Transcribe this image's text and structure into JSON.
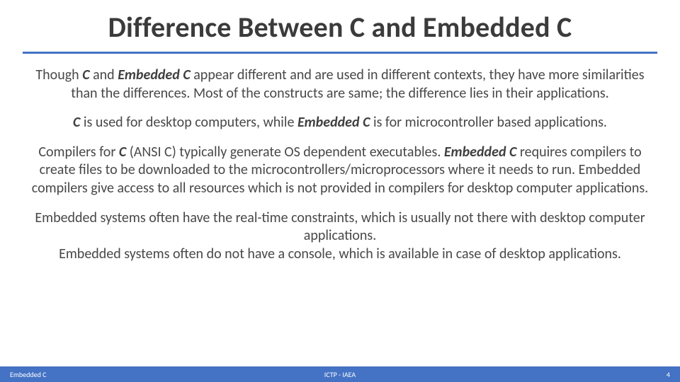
{
  "title": "Difference Between C and Embedded C",
  "paras": {
    "p1a": "Though ",
    "p1b": "C",
    "p1c": " and ",
    "p1d": "Embedded C",
    "p1e": " appear different and are used in different contexts, they have more similarities than the differences. Most of the constructs are same; the difference lies in their applications.",
    "p2a": "C",
    "p2b": " is used for desktop computers, while ",
    "p2c": "Embedded C",
    "p2d": " is for microcontroller based applications.",
    "p3a": "Compilers for ",
    "p3b": "C",
    "p3c": " (ANSI C) typically generate OS dependent executables. ",
    "p3d": "Embedded C",
    "p3e": " requires compilers to create files to be downloaded to the microcontrollers/microprocessors where it needs to run. Embedded compilers give access to all resources which is not provided in compilers for desktop computer applications.",
    "p4": "Embedded systems often have the real-time constraints, which is usually not there with desktop computer applications.",
    "p5": "Embedded systems often do not have a console, which is available in case of desktop applications."
  },
  "footer": {
    "left": "Embedded C",
    "center": "ICTP - IAEA",
    "right": "4"
  }
}
